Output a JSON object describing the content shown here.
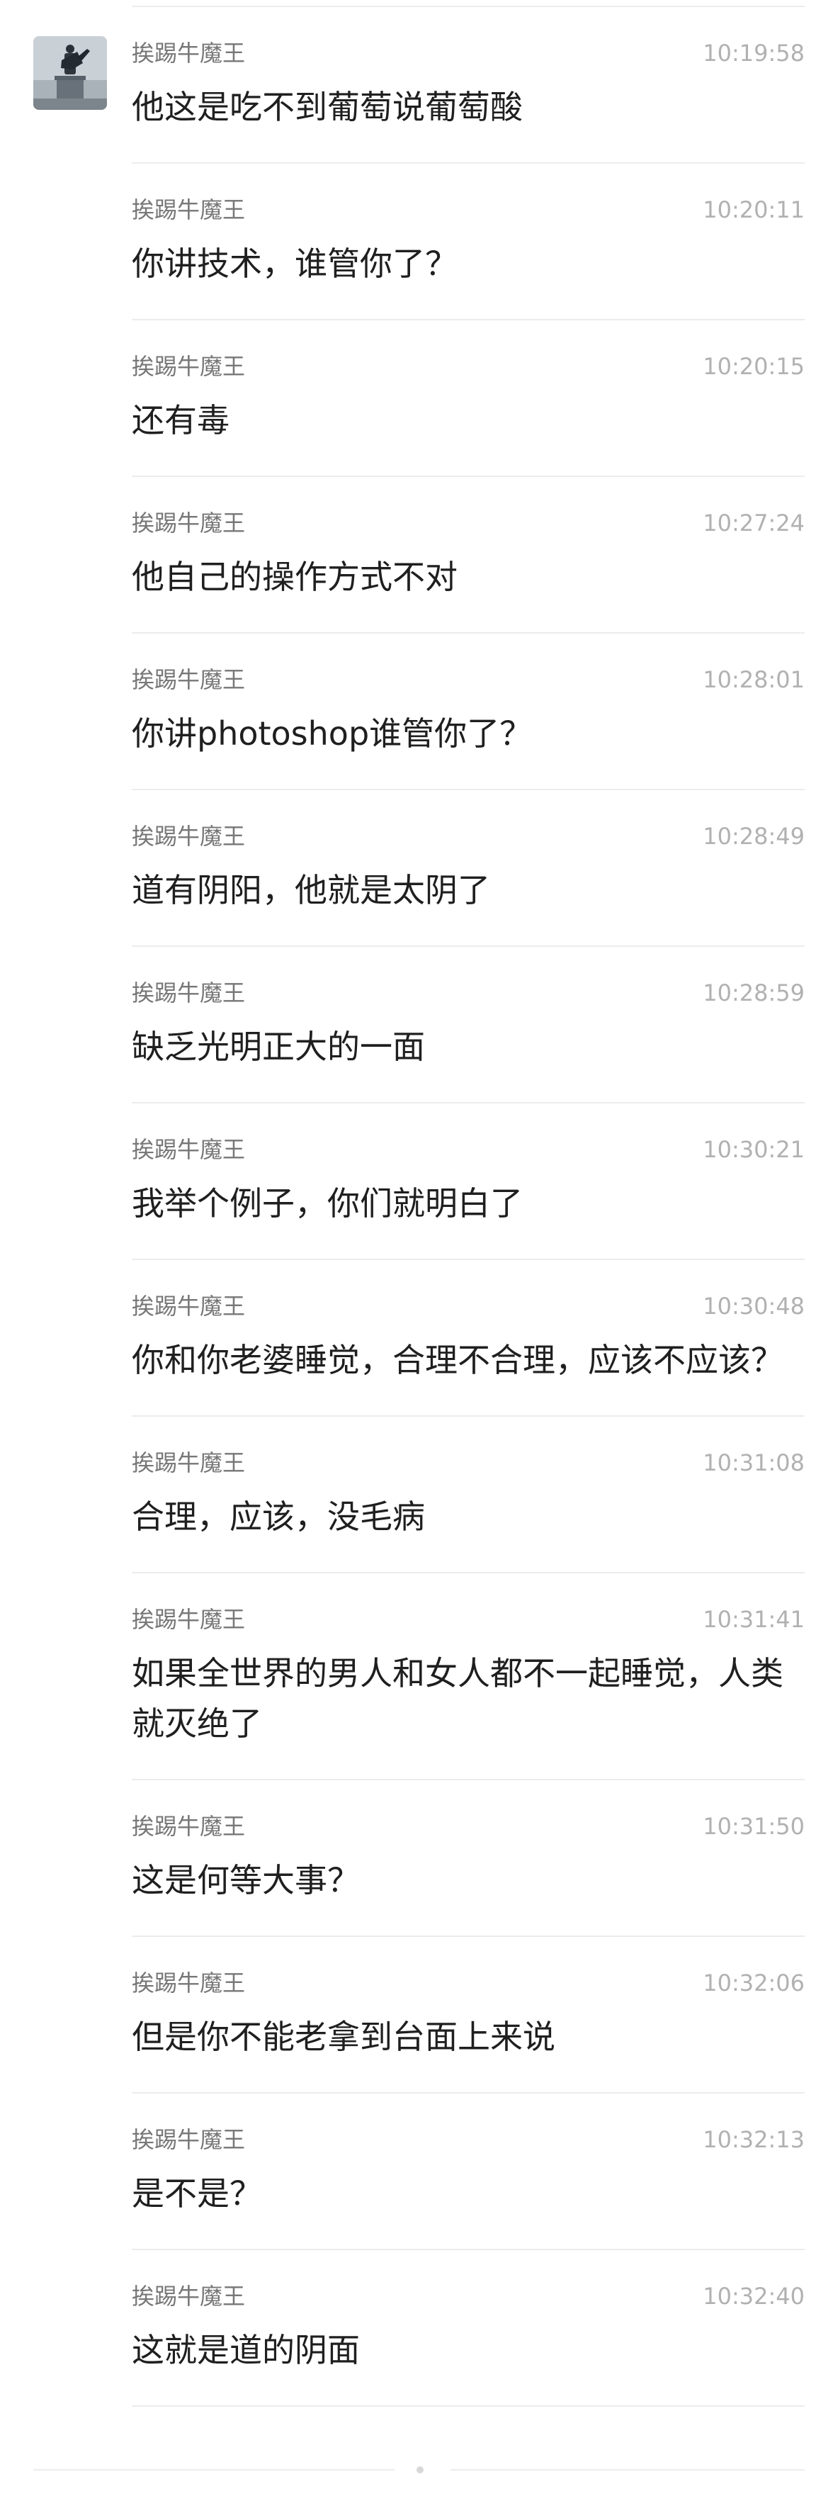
{
  "avatar_icon": "avatar-image",
  "messages": [
    {
      "sender": "挨踢牛魔王",
      "time": "10:19:58",
      "text": "他这是吃不到葡萄说葡萄酸"
    },
    {
      "sender": "挨踢牛魔王",
      "time": "10:20:11",
      "text": "你讲技术，谁管你了？"
    },
    {
      "sender": "挨踢牛魔王",
      "time": "10:20:15",
      "text": "还有毒"
    },
    {
      "sender": "挨踢牛魔王",
      "time": "10:27:24",
      "text": "他自己的操作方式不对"
    },
    {
      "sender": "挨踢牛魔王",
      "time": "10:28:01",
      "text": "你讲photoshop谁管你了？"
    },
    {
      "sender": "挨踢牛魔王",
      "time": "10:28:49",
      "text": "道有阴阳，他就是太阴了"
    },
    {
      "sender": "挨踢牛魔王",
      "time": "10:28:59",
      "text": "缺乏光明正大的一面"
    },
    {
      "sender": "挨踢牛魔王",
      "time": "10:30:21",
      "text": "我举个例子，你们就明白了"
    },
    {
      "sender": "挨踢牛魔王",
      "time": "10:30:48",
      "text": "你和你老婆睡觉，合理不合理，应该不应该？"
    },
    {
      "sender": "挨踢牛魔王",
      "time": "10:31:08",
      "text": "合理，应该，没毛病"
    },
    {
      "sender": "挨踢牛魔王",
      "time": "10:31:41",
      "text": "如果全世界的男人和女人都不一起睡觉，人类就灭绝了"
    },
    {
      "sender": "挨踢牛魔王",
      "time": "10:31:50",
      "text": "这是何等大事？"
    },
    {
      "sender": "挨踢牛魔王",
      "time": "10:32:06",
      "text": "但是你不能老拿到台面上来说"
    },
    {
      "sender": "挨踢牛魔王",
      "time": "10:32:13",
      "text": "是不是？"
    },
    {
      "sender": "挨踢牛魔王",
      "time": "10:32:40",
      "text": "这就是道的阴面"
    }
  ]
}
